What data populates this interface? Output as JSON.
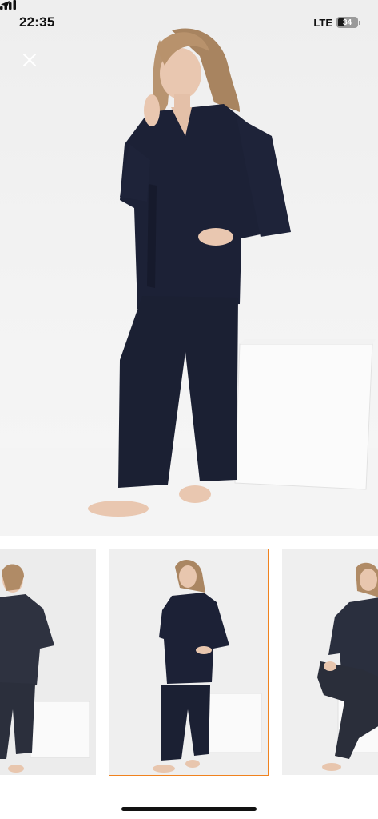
{
  "status_bar": {
    "time": "22:35",
    "network": "LTE",
    "battery_level": "34",
    "battery_fraction": 0.34
  },
  "viewer": {
    "close_icon": "close-icon",
    "selected_index": 1,
    "thumbnails": [
      {
        "name": "thumbnail-1",
        "selected": false
      },
      {
        "name": "thumbnail-2",
        "selected": true
      },
      {
        "name": "thumbnail-3",
        "selected": false
      }
    ]
  },
  "colors": {
    "selected_outline": "#f0821e",
    "garment": "#1c2136"
  }
}
